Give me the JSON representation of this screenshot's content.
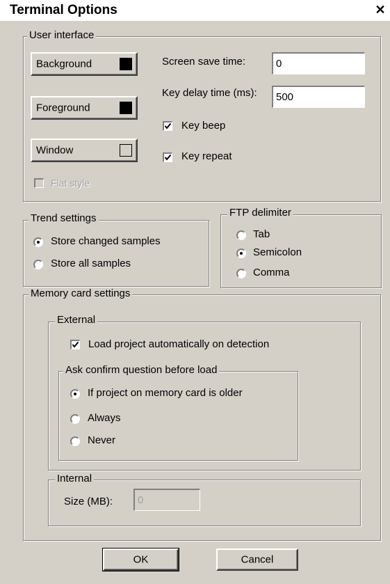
{
  "window": {
    "title": "Terminal Options",
    "close_glyph": "✕"
  },
  "user_interface": {
    "legend": "User interface",
    "background_button": "Background",
    "background_color": "#000000",
    "foreground_button": "Foreground",
    "foreground_color": "#000000",
    "window_button": "Window",
    "window_color": "#d4d0c8",
    "flat_style_label": "Flat style",
    "flat_style_checked": false,
    "screen_save_label": "Screen save time:",
    "screen_save_value": "0",
    "key_delay_label": "Key delay time (ms):",
    "key_delay_value": "500",
    "key_beep_label": "Key beep",
    "key_beep_checked": true,
    "key_repeat_label": "Key repeat",
    "key_repeat_checked": true
  },
  "trend_settings": {
    "legend": "Trend settings",
    "options": [
      "Store changed samples",
      "Store all samples"
    ],
    "selected": "Store changed samples"
  },
  "ftp_delimiter": {
    "legend": "FTP delimiter",
    "options": [
      "Tab",
      "Semicolon",
      "Comma"
    ],
    "selected": "Semicolon"
  },
  "memory_card": {
    "legend": "Memory card settings",
    "external": {
      "legend": "External",
      "load_auto_label": "Load project automatically on detection",
      "load_auto_checked": true,
      "confirm": {
        "legend": "Ask confirm question before load",
        "options": [
          "If project on memory card is older",
          "Always",
          "Never"
        ],
        "selected": "If project on memory card is older"
      }
    },
    "internal": {
      "legend": "Internal",
      "size_label": "Size (MB):",
      "size_value": "0"
    }
  },
  "buttons": {
    "ok": "OK",
    "cancel": "Cancel"
  }
}
